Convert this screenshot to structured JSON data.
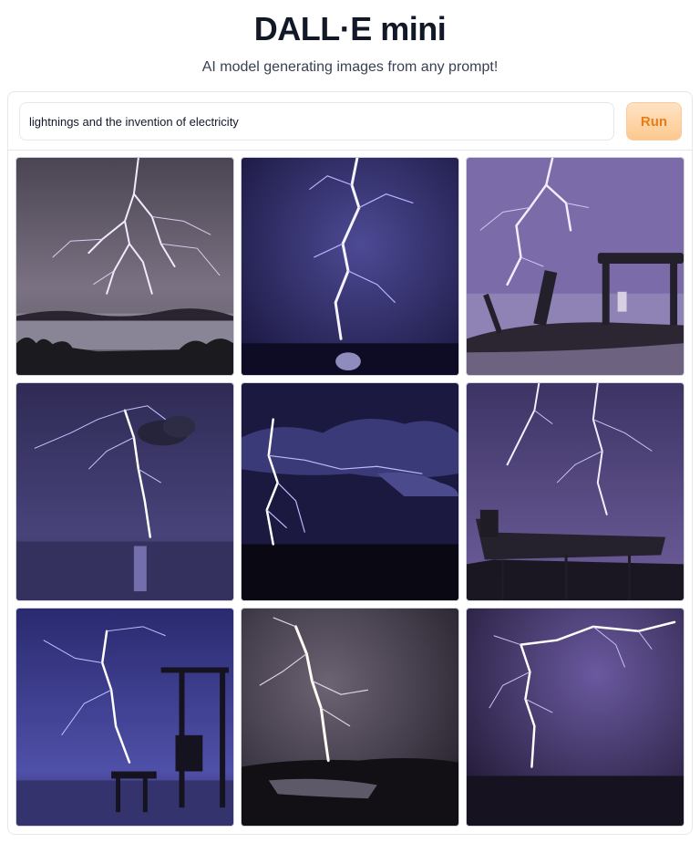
{
  "header": {
    "title": "DALL·E mini",
    "subtitle": "AI model generating images from any prompt!"
  },
  "prompt": {
    "value": "lightnings and the invention of electricity",
    "run_label": "Run"
  },
  "gallery": {
    "images": [
      {
        "subject": "lightning over lake with tree silhouettes",
        "sky": "#6e6478"
      },
      {
        "subject": "lightning bolt striking water",
        "sky": "#3a3370"
      },
      {
        "subject": "lightning behind machinery silhouette",
        "sky": "#7d6aa8"
      },
      {
        "subject": "lightning over calm sea with cloud",
        "sky": "#3b3568"
      },
      {
        "subject": "lightning under dark storm clouds",
        "sky": "#1f1d4a"
      },
      {
        "subject": "lightning behind boat silhouette",
        "sky": "#5e4f8a"
      },
      {
        "subject": "lightning over dock and crane silhouette",
        "sky": "#3c3c86"
      },
      {
        "subject": "bright lightning over dark water",
        "sky": "#3a2f40"
      },
      {
        "subject": "lightning across purple night sky",
        "sky": "#3a2a55"
      }
    ]
  },
  "colors": {
    "run_text": "#ea7c16",
    "run_bg": "#fdd7ab",
    "border": "#e5e7eb"
  }
}
